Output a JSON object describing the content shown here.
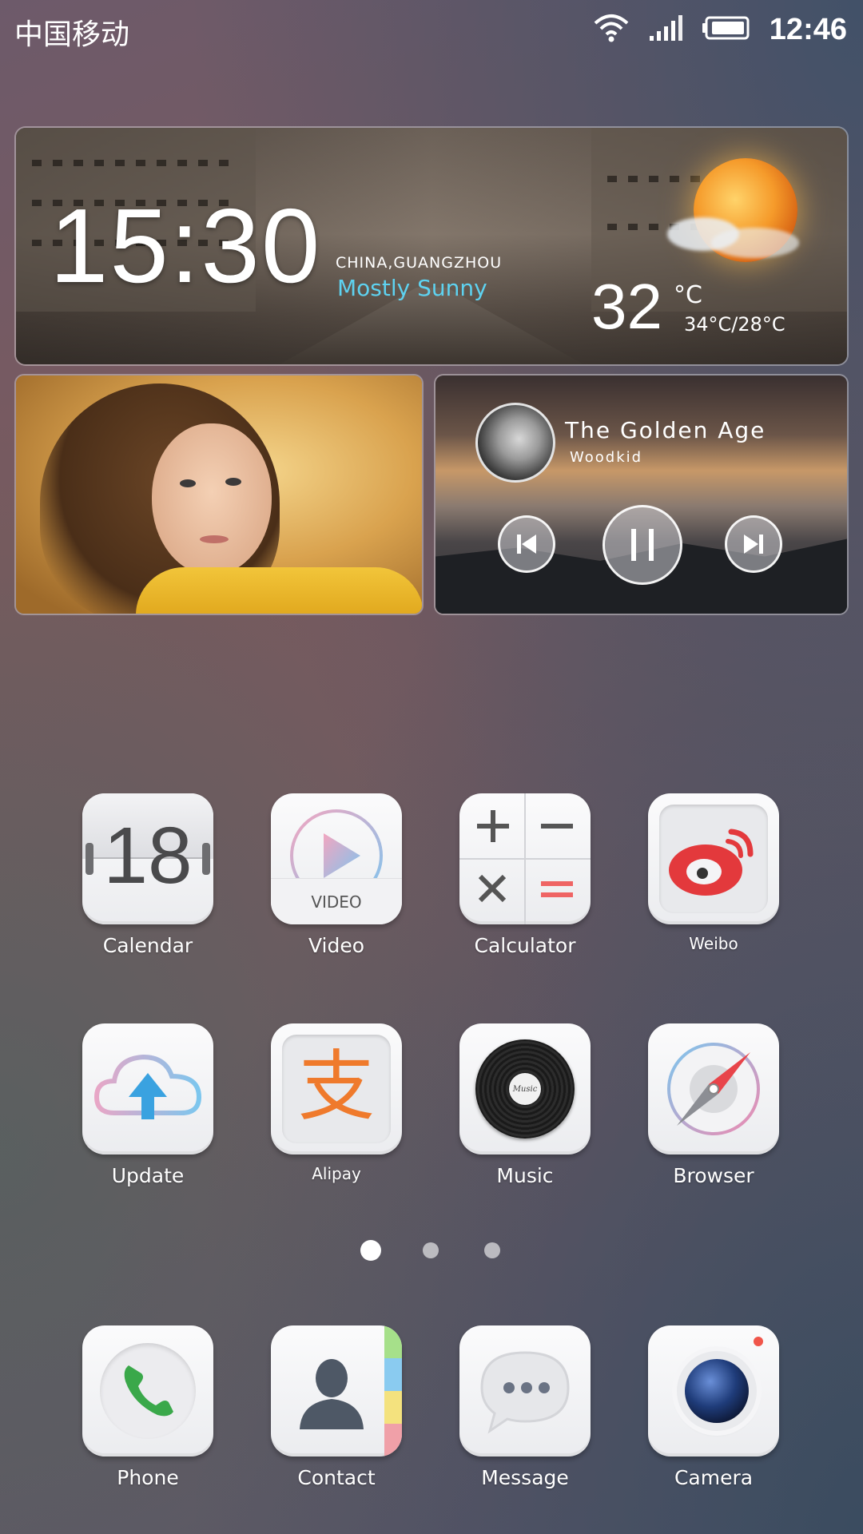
{
  "status_bar": {
    "carrier": "中国移动",
    "time": "12:46",
    "icons": [
      "wifi-icon",
      "cellular-signal-icon",
      "battery-icon"
    ]
  },
  "weather_widget": {
    "time": "15:30",
    "location": "CHINA,GUANGZHOU",
    "condition": "Mostly Sunny",
    "temperature": "32",
    "unit": "°C",
    "range": "34°C/28°C",
    "icon": "partly-sunny-icon"
  },
  "photo_widget": {
    "subject": "portrait-photo"
  },
  "music_widget": {
    "title": "The Golden Age",
    "artist": "Woodkid",
    "controls": [
      "previous-icon",
      "pause-icon",
      "next-icon"
    ]
  },
  "apps": {
    "calendar": {
      "label": "Calendar",
      "day": "18"
    },
    "video": {
      "label": "Video",
      "badge": "VIDEO"
    },
    "calculator": {
      "label": "Calculator"
    },
    "weibo": {
      "label": "Weibo"
    },
    "update": {
      "label": "Update"
    },
    "alipay": {
      "label": "Alipay",
      "glyph": "支"
    },
    "music": {
      "label": "Music",
      "disc_text": "Music"
    },
    "browser": {
      "label": "Browser"
    }
  },
  "page_indicator": {
    "pages": 3,
    "current": 1
  },
  "dock": {
    "phone": {
      "label": "Phone"
    },
    "contact": {
      "label": "Contact"
    },
    "message": {
      "label": "Message"
    },
    "camera": {
      "label": "Camera"
    }
  },
  "colors": {
    "condition_text": "#5ed2f0",
    "weibo_red": "#e3393c",
    "alipay_orange": "#ef7a2c",
    "phone_green": "#3aa84a"
  }
}
